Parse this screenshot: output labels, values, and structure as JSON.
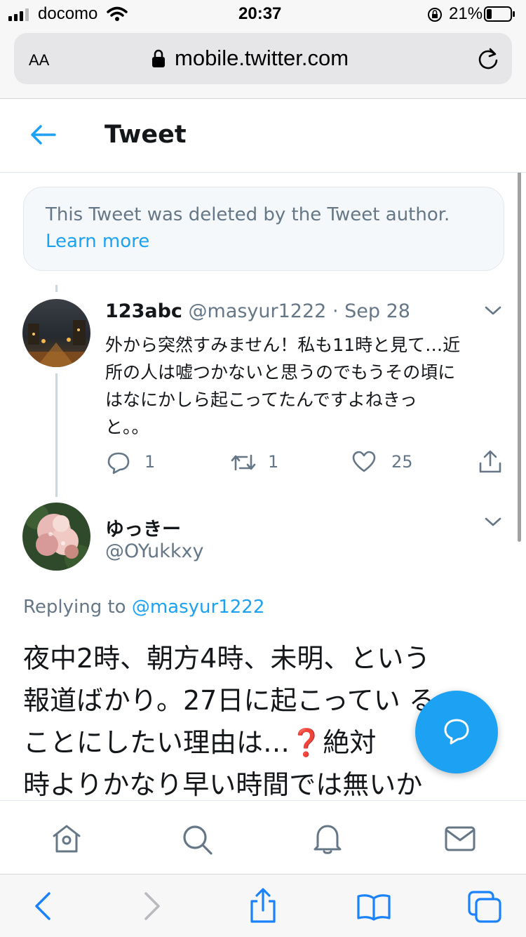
{
  "status_bar": {
    "carrier": "docomo",
    "time": "20:37",
    "battery": "21%"
  },
  "browser": {
    "text_size_label": "AA",
    "url": "mobile.twitter.com"
  },
  "header": {
    "title": "Tweet"
  },
  "deleted_notice": {
    "text": "This Tweet was deleted by the Tweet author.",
    "link": "Learn more"
  },
  "reply_tweet": {
    "display_name": "123abc",
    "handle": "@masyur1222",
    "separator": "·",
    "date": "Sep 28",
    "text_lines": [
      "外から突然すみません！私も11時と見て…近",
      "所の人は嘘つかないと思うのでもうその頃に",
      "はなにかしら起こってたんですよねきっ",
      "と。。"
    ],
    "reply_count": "1",
    "retweet_count": "1",
    "like_count": "25"
  },
  "main_tweet": {
    "display_name": "ゆっきー",
    "handle": "@OYukkxy",
    "replying_prefix": "Replying to",
    "replying_handle": "@masyur1222",
    "text_lines": [
      "夜中2時、朝方4時、未明、という",
      "報道ばかり。27日に起こってい る",
      "ことにしたい理由は…❓絶対",
      "時よりかなり早い時間では無いか"
    ]
  },
  "colors": {
    "accent": "#1da1f2",
    "secondary_text": "#657786",
    "border": "#e1e8ed"
  },
  "icons": {
    "back": "arrow-left-icon",
    "chevron": "chevron-down-icon",
    "reply": "comment-icon",
    "retweet": "retweet-icon",
    "like": "heart-icon",
    "share": "share-icon",
    "compose": "compose-reply-icon",
    "home": "home-icon",
    "search": "search-icon",
    "notifications": "bell-icon",
    "messages": "mail-icon"
  }
}
